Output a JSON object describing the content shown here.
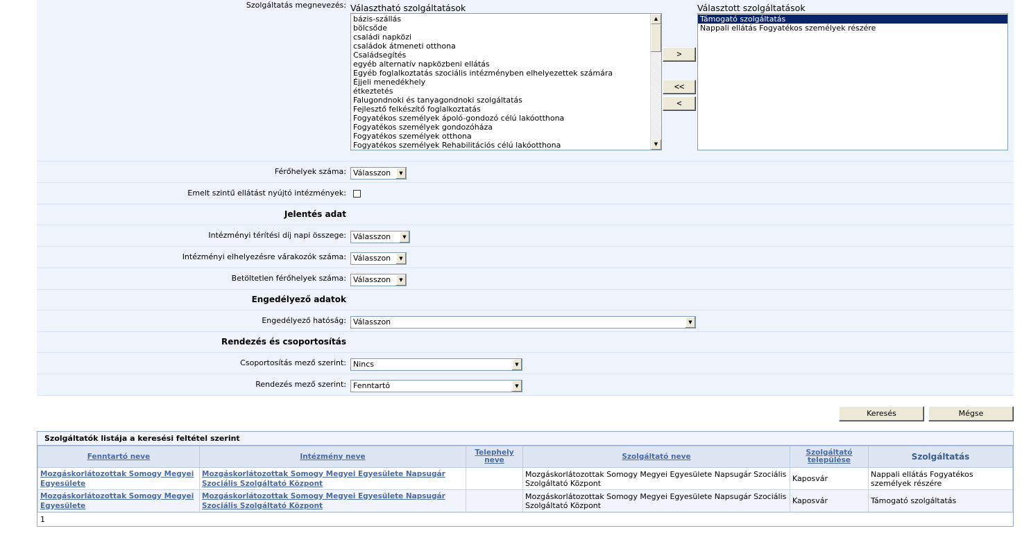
{
  "services": {
    "label": "Szolgáltatás megnevezés:",
    "available_title": "Választható szolgáltatások",
    "selected_title": "Választott szolgáltatások",
    "available": [
      "bázis-szállás",
      "bölcsőde",
      "családi napközi",
      "családok átmeneti otthona",
      "Családsegítés",
      "egyéb alternatív napközbeni ellátás",
      "Egyéb foglalkoztatás szociális intézményben elhelyezettek számára",
      "Éjjeli menedékhely",
      "étkeztetés",
      "Falugondnoki és tanyagondnoki szolgáltatás",
      "Fejlesztő felkészítő foglalkoztatás",
      "Fogyatékos személyek ápoló-gondozó célú lakóotthona",
      "Fogyatékos személyek gondozóháza",
      "Fogyatékos személyek otthona",
      "Fogyatékos személyek Rehabilitációs célú lakóotthona"
    ],
    "selected": [
      "Támogató szolgáltatás",
      "Nappali ellátás Fogyatékos személyek részére"
    ],
    "buttons": {
      "add": ">",
      "remove_all": "<<",
      "remove": "<"
    }
  },
  "form": {
    "ferohelyek_label": "Férőhelyek száma:",
    "ferohelyek_value": "Válasszon",
    "emelt_label": "Emelt szintű ellátást nyújtó intézmények:",
    "emelt_checked": false,
    "section_jelentes": "Jelentés adat",
    "teritesi_label": "Intézményi térítési díj napi összege:",
    "teritesi_value": "Válasszon",
    "varakozok_label": "Intézményi elhelyezésre várakozók száma:",
    "varakozok_value": "Válasszon",
    "betoltetlen_label": "Betöltetlen férőhelyek száma:",
    "betoltetlen_value": "Válasszon",
    "section_engedelyezo": "Engedélyező adatok",
    "hatosag_label": "Engedélyező hatóság:",
    "hatosag_value": "Válasszon",
    "section_rendezes": "Rendezés és csoportosítás",
    "csoport_label": "Csoportosítás mező szerint:",
    "csoport_value": "Nincs",
    "rendezes_label": "Rendezés mező szerint:",
    "rendezes_value": "Fenntartó"
  },
  "actions": {
    "search": "Keresés",
    "cancel": "Mégse"
  },
  "results": {
    "caption": "Szolgáltatók listája a keresési feltétel szerint",
    "headers": [
      "Fenntartó neve",
      "Intézmény neve",
      "Telephely neve",
      "Szolgáltató neve",
      "Szolgáltató települése",
      "Szolgáltatás"
    ],
    "rows": [
      {
        "fenntarto": "Mozgáskorlátozottak Somogy Megyei Egyesülete",
        "intezmeny": "Mozgáskorlátozottak Somogy Megyei Egyesülete Napsugár Szociális Szolgáltató Központ",
        "telephely": "",
        "szolgaltato": "Mozgáskorlátozottak Somogy Megyei Egyesülete Napsugár Szociális Szolgáltató Központ",
        "telepules": "Kaposvár",
        "szolgaltatas": "Nappali ellátás Fogyatékos személyek részére"
      },
      {
        "fenntarto": "Mozgáskorlátozottak Somogy Megyei Egyesülete",
        "intezmeny": "Mozgáskorlátozottak Somogy Megyei Egyesülete Napsugár Szociális Szolgáltató Központ",
        "telephely": "",
        "szolgaltato": "Mozgáskorlátozottak Somogy Megyei Egyesülete Napsugár Szociális Szolgáltató Központ",
        "telepules": "Kaposvár",
        "szolgaltatas": "Támogató szolgáltatás"
      }
    ],
    "page": "1"
  }
}
